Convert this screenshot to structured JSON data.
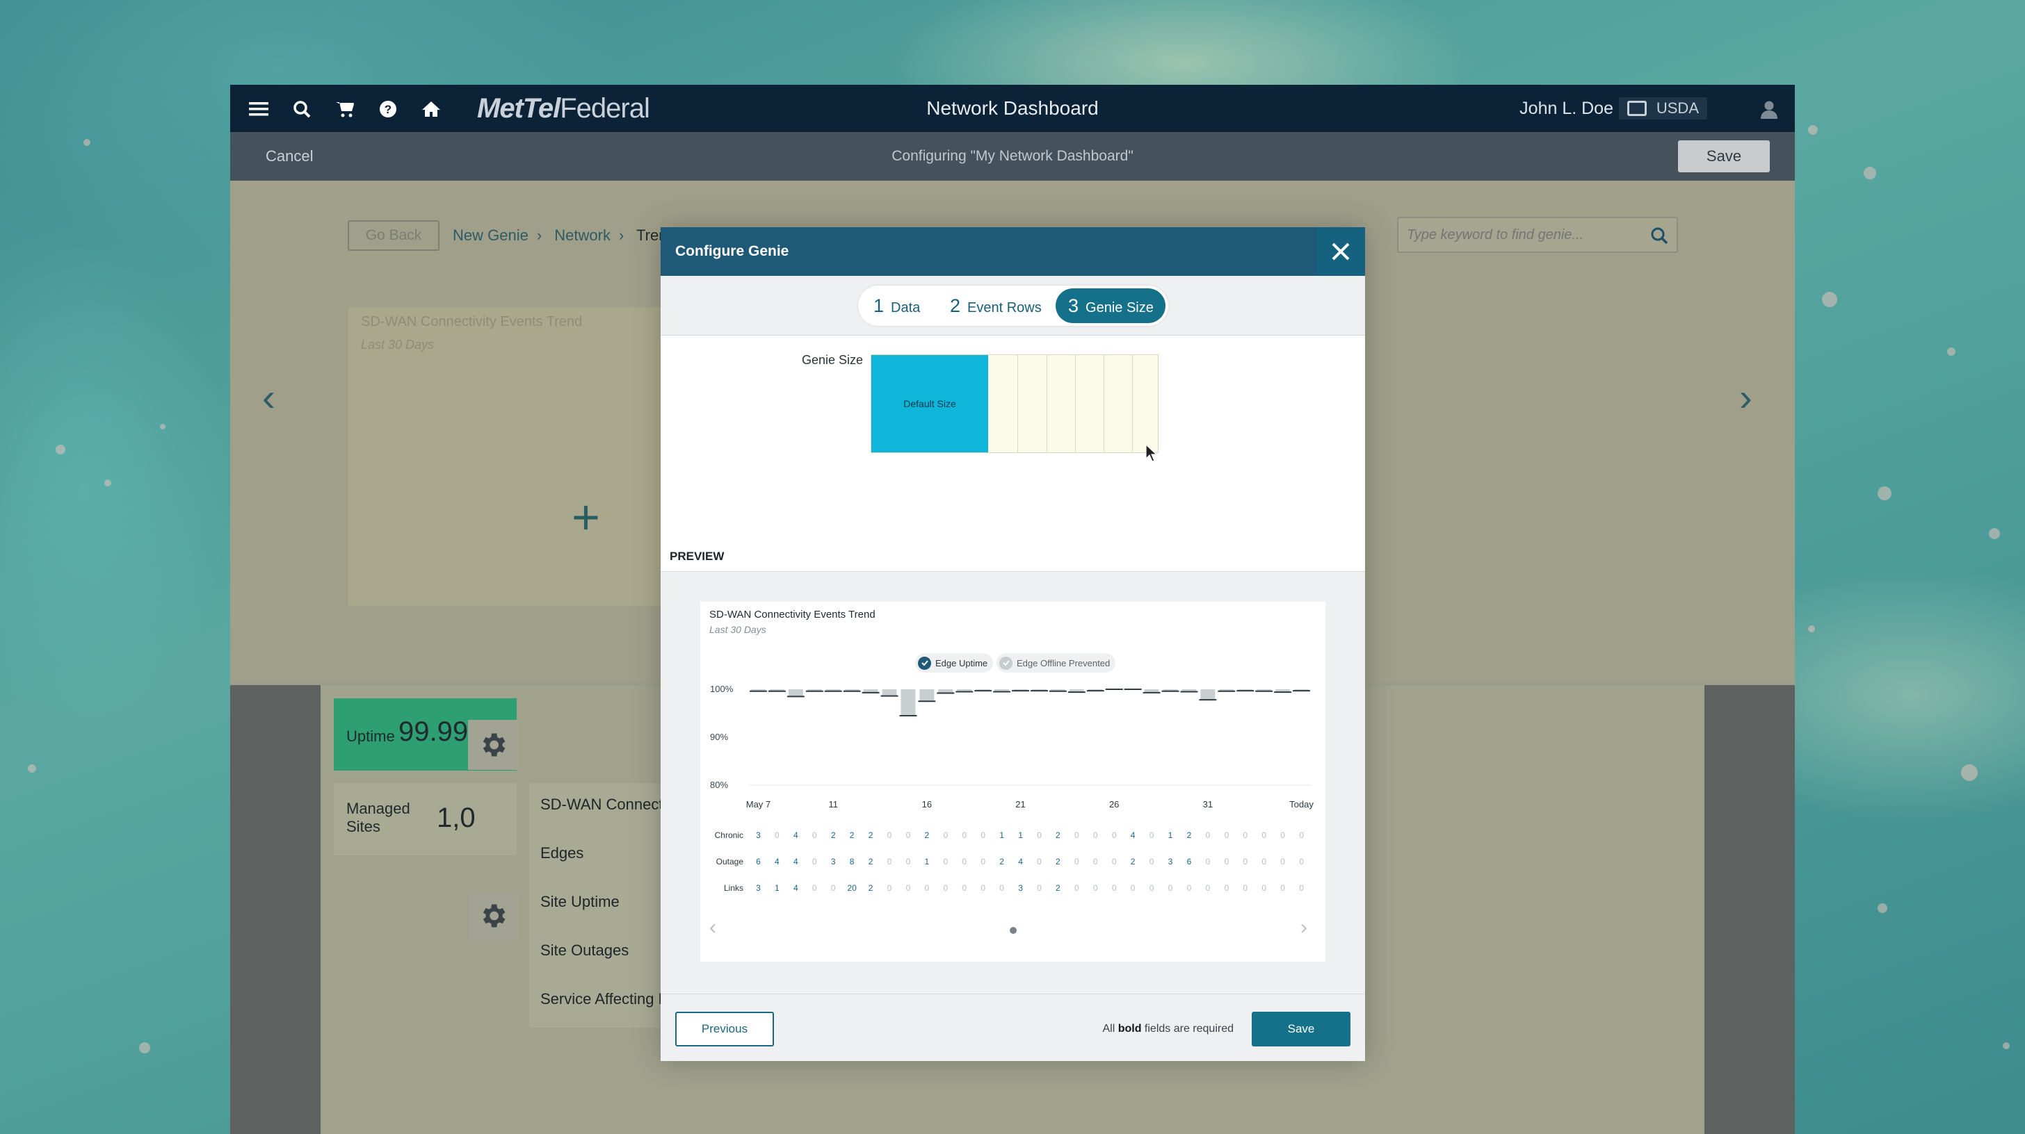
{
  "header": {
    "brand": {
      "part1": "MetTel",
      "part2": "Federal"
    },
    "title": "Network Dashboard",
    "user_name": "John L. Doe",
    "agency": "USDA"
  },
  "subheader": {
    "cancel_label": "Cancel",
    "configuring_text": "Configuring \"My Network Dashboard\"",
    "save_label": "Save"
  },
  "page": {
    "go_back": "Go Back",
    "breadcrumbs": [
      "New Genie",
      "Network",
      "Tren"
    ],
    "search_placeholder": "Type keyword to find genie...",
    "ghost_card_title": "SD-WAN Connectivity Events Trend",
    "ghost_card_sub": "Last 30 Days",
    "tiles": [
      {
        "label": "Uptime",
        "value": "99.99"
      },
      {
        "label_line1": "Managed",
        "label_line2": "Sites",
        "value": "1,0"
      }
    ],
    "menu_items": [
      "SD-WAN Connect",
      "Edges",
      "Site Uptime",
      "Site Outages",
      "Service Affecting L"
    ]
  },
  "modal": {
    "title": "Configure Genie",
    "steps": [
      {
        "num": "1",
        "label": "Data"
      },
      {
        "num": "2",
        "label": "Event Rows"
      },
      {
        "num": "3",
        "label": "Genie Size"
      }
    ],
    "active_step": 3,
    "genie_size_label": "Genie Size",
    "default_size_label": "Default Size",
    "preview_label": "PREVIEW",
    "footer": {
      "previous_label": "Previous",
      "required_prefix": "All",
      "required_bold": "bold",
      "required_suffix": "fields are required",
      "save_label": "Save"
    }
  },
  "preview": {
    "title": "SD-WAN Connectivity Events Trend",
    "subtitle": "Last 30 Days",
    "legend": [
      {
        "label": "Edge Uptime",
        "checked": true,
        "color": "#1f5a78"
      },
      {
        "label": "Edge Offline Prevented",
        "checked": false,
        "color": "#c7cccf"
      }
    ],
    "colors": {
      "bar": "#c9ced1",
      "line": "#2f3a42",
      "value": "#1a6784",
      "zero": "#b7bfc4"
    }
  },
  "chart_data": {
    "type": "bar",
    "title": "SD-WAN Connectivity Events Trend",
    "subtitle": "Last 30 Days",
    "ylim": [
      80,
      100
    ],
    "y_ticks": [
      "100%",
      "90%",
      "80%"
    ],
    "y_tick_values": [
      100,
      90,
      80
    ],
    "x_tick_labels": [
      {
        "index": 0,
        "label": "May 7"
      },
      {
        "index": 4,
        "label": "11"
      },
      {
        "index": 9,
        "label": "16"
      },
      {
        "index": 14,
        "label": "21"
      },
      {
        "index": 19,
        "label": "26"
      },
      {
        "index": 24,
        "label": "31"
      },
      {
        "index": 29,
        "label": "Today"
      }
    ],
    "series": [
      {
        "name": "Edge Uptime",
        "values": [
          99.6,
          99.6,
          98.5,
          99.6,
          99.6,
          99.6,
          99.3,
          98.6,
          94.5,
          97.5,
          99.2,
          99.5,
          99.7,
          99.5,
          99.7,
          99.7,
          99.6,
          99.4,
          99.7,
          100.0,
          100.0,
          99.3,
          99.6,
          99.5,
          97.8,
          99.6,
          99.7,
          99.6,
          99.4,
          99.7
        ]
      }
    ],
    "table": {
      "rows": [
        {
          "label": "Chronic",
          "values": [
            3,
            0,
            4,
            0,
            2,
            2,
            2,
            0,
            0,
            2,
            0,
            0,
            0,
            1,
            1,
            0,
            2,
            0,
            0,
            0,
            4,
            0,
            1,
            2,
            0,
            0,
            0,
            0,
            0,
            0
          ]
        },
        {
          "label": "Outage",
          "values": [
            6,
            4,
            4,
            0,
            3,
            8,
            2,
            0,
            0,
            1,
            0,
            0,
            0,
            2,
            4,
            0,
            2,
            0,
            0,
            0,
            2,
            0,
            3,
            6,
            0,
            0,
            0,
            0,
            0,
            0
          ]
        },
        {
          "label": "Links",
          "values": [
            3,
            1,
            4,
            0,
            0,
            20,
            2,
            0,
            0,
            0,
            0,
            0,
            0,
            0,
            3,
            0,
            2,
            0,
            0,
            0,
            0,
            0,
            0,
            0,
            0,
            0,
            0,
            0,
            0,
            0
          ]
        }
      ]
    }
  }
}
